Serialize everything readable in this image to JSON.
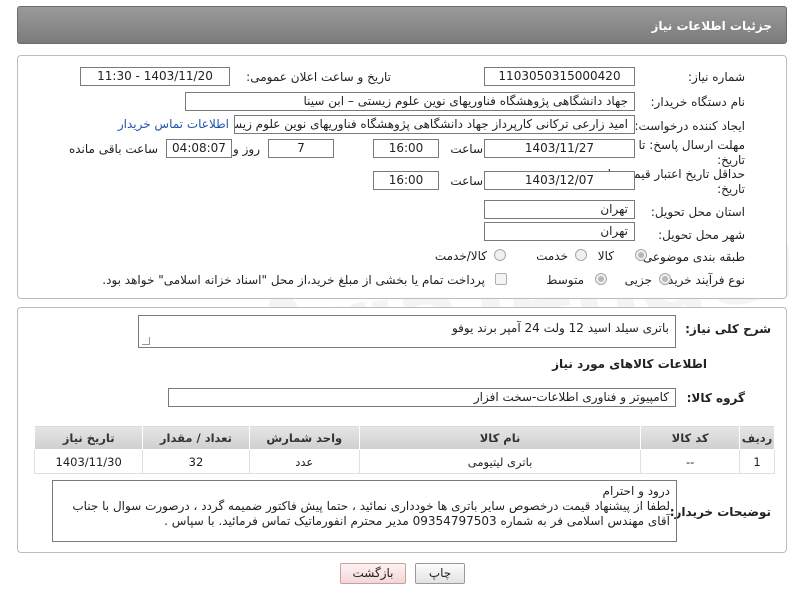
{
  "header": {
    "title": "جزئیات اطلاعات نیاز"
  },
  "watermark": {
    "text": "AriaTender.neT"
  },
  "form": {
    "need_number_label": "شماره نیاز:",
    "need_number": "1103050315000420",
    "announce_label": "تاریخ و ساعت اعلان عمومی:",
    "announce_value": "1403/11/20 - 11:30",
    "buyer_org_label": "نام دستگاه خریدار:",
    "buyer_org": "جهاد دانشگاهی پژوهشگاه فناوریهای نوین علوم زیستی – ابن سینا",
    "creator_label": "ایجاد کننده درخواست:",
    "creator": "امید  زارعی ترکانی  کارپرداز جهاد دانشگاهی پژوهشگاه فناوریهای نوین علوم زیستی",
    "contact_link": "اطلاعات تماس خریدار",
    "deadline_label_1": "مهلت ارسال پاسخ: تا",
    "deadline_label_2": "تاریخ:",
    "deadline_date": "1403/11/27",
    "time_label": "ساعت",
    "deadline_time": "16:00",
    "days_value": "7",
    "days_label": "روز و",
    "remaining_time": "04:08:07",
    "remaining_label": "ساعت باقی مانده",
    "validity_label_1": "حداقل تاریخ اعتبار قیمت: تا",
    "validity_label_2": "تاریخ:",
    "validity_date": "1403/12/07",
    "validity_time": "16:00",
    "province_label": "استان محل تحویل:",
    "province": "تهران",
    "city_label": "شهر محل تحویل:",
    "city": "تهران",
    "category_label": "طبقه بندی موضوعی:",
    "category_options": [
      "کالا",
      "خدمت",
      "کالا/خدمت"
    ],
    "purchase_label": "نوع فرآیند خرید :",
    "purchase_options": [
      "جزیی",
      "متوسط"
    ],
    "payment_note": "پرداخت تمام یا بخشی از مبلغ خرید،از محل \"اسناد خزانه اسلامی\" خواهد بود."
  },
  "summary": {
    "label": "شرح کلی نیاز:",
    "text": "باتری سیلد اسید  12 ولت 24 آمپر برند یوفو"
  },
  "goods": {
    "section_title": "اطلاعات کالاهای مورد نیاز",
    "group_label": "گروه کالا:",
    "group_value": "کامپیوتر و فناوری اطلاعات-سخت افزار",
    "columns": [
      "ردیف",
      "کد کالا",
      "نام کالا",
      "واحد شمارش",
      "تعداد / مقدار",
      "تاریخ نیاز"
    ],
    "rows": [
      {
        "row": "1",
        "code": "--",
        "name": "باتری لیتیومی",
        "unit": "عدد",
        "qty": "32",
        "date": "1403/11/30"
      }
    ]
  },
  "buyer_notes": {
    "label": "توضیحات خریدار:",
    "text": "درود و احترام\nلطفا از پیشنهاد قیمت درخصوص سایر باتری ها خودداری نمائید ، حتما پیش فاکتور ضمیمه گردد ، درصورت سوال با جناب آقای مهندس اسلامی فر به شماره 09354797503 مدیر محترم انفورماتیک تماس فرمائید. با سپاس ."
  },
  "buttons": {
    "print": "چاپ",
    "back": "بازگشت"
  }
}
